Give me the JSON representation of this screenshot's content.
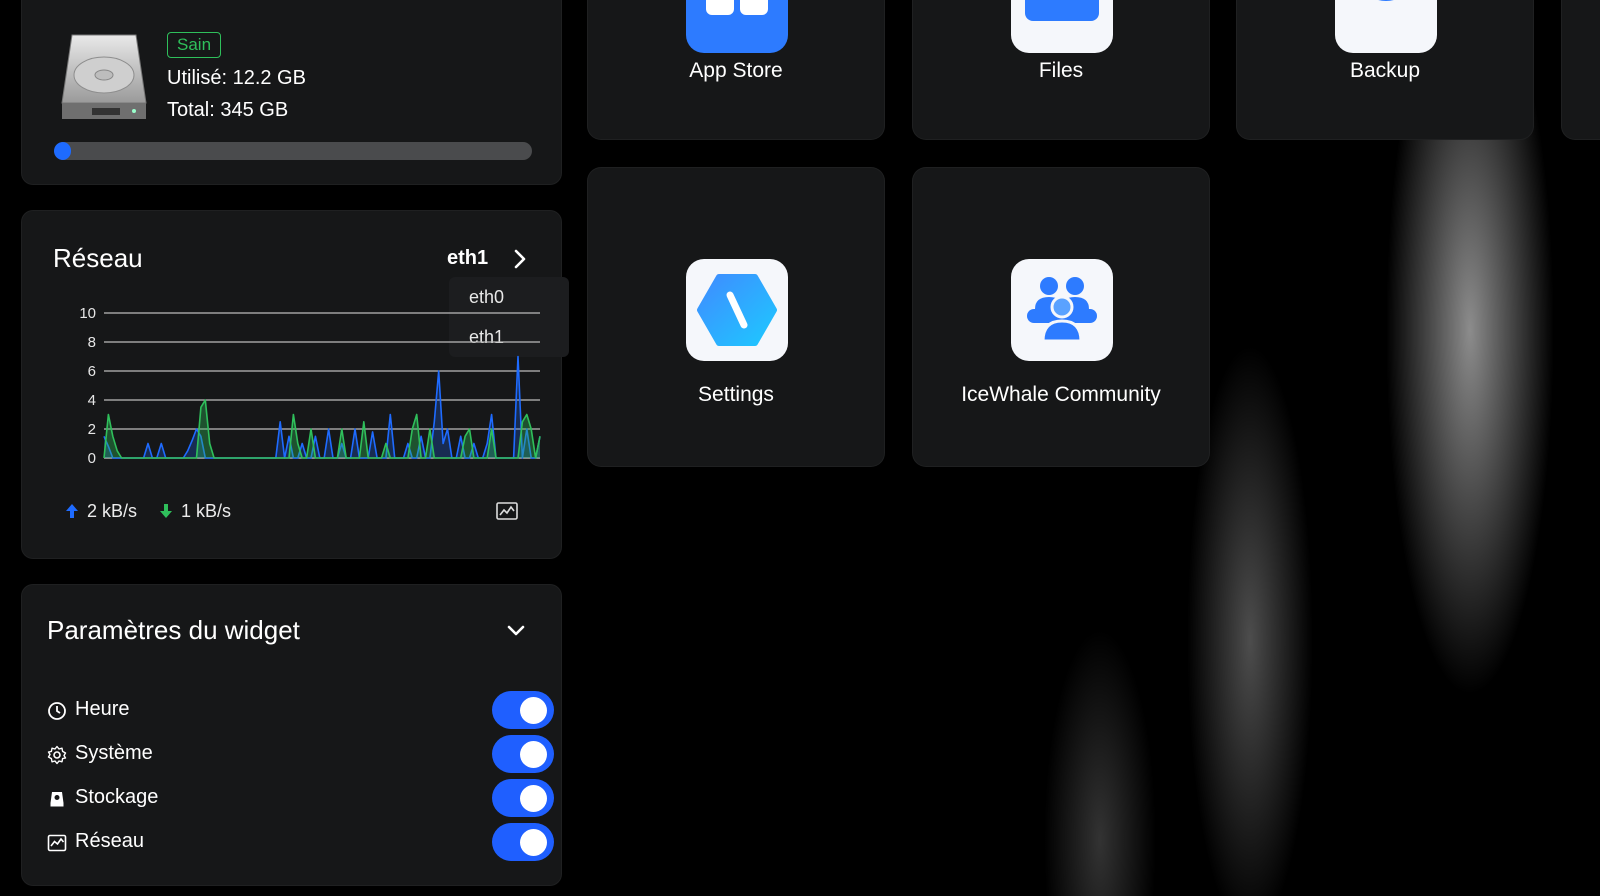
{
  "storage": {
    "status_badge": "Sain",
    "used": "Utilisé: 12.2 GB",
    "total": "Total: 345 GB",
    "usage_fraction": 0.035,
    "icon": "hard-disk-icon"
  },
  "network": {
    "title": "Réseau",
    "selected_interface": "eth1",
    "interfaces": [
      "eth0",
      "eth1"
    ],
    "upload": "2 kB/s",
    "download": "1 kB/s",
    "colors": {
      "upload": "#1e6bff",
      "download": "#2fbf5b"
    }
  },
  "chart_data": {
    "type": "area",
    "y_ticks": [
      "10",
      "8",
      "6",
      "4",
      "2",
      "0"
    ],
    "ylim": [
      0,
      10
    ],
    "x": [
      0,
      1,
      2,
      3,
      4,
      5,
      6,
      7,
      8,
      9,
      10,
      11,
      12,
      13,
      14,
      15,
      16,
      17,
      18,
      19,
      20,
      21,
      22,
      23,
      24,
      25,
      26,
      27,
      28,
      29,
      30,
      31,
      32,
      33,
      34,
      35,
      36,
      37,
      38,
      39,
      40,
      41,
      42,
      43,
      44,
      45,
      46,
      47,
      48,
      49,
      50,
      51,
      52,
      53,
      54,
      55,
      56,
      57,
      58,
      59,
      60,
      61,
      62,
      63,
      64,
      65,
      66,
      67,
      68,
      69,
      70,
      71,
      72,
      73,
      74,
      75,
      76,
      77,
      78,
      79,
      80,
      81,
      82,
      83,
      84,
      85,
      86,
      87,
      88,
      89,
      90,
      91,
      92,
      93,
      94,
      95,
      96,
      97,
      98,
      99
    ],
    "series": [
      {
        "values": [
          1.5,
          0.8,
          0,
          0,
          0,
          0,
          0,
          0,
          0,
          0,
          1,
          0,
          0,
          1,
          0,
          0,
          0,
          0,
          0,
          0.5,
          1.2,
          2,
          1.5,
          0,
          0,
          0,
          0,
          0,
          0,
          0,
          0,
          0,
          0,
          0,
          0,
          0,
          0,
          0,
          0,
          0,
          2.5,
          0,
          1.5,
          0,
          0,
          1,
          0,
          0,
          1.5,
          0,
          0,
          2,
          0,
          0,
          1,
          0,
          0,
          2,
          0,
          0,
          0,
          1.8,
          0,
          0,
          0,
          3,
          0,
          0,
          0,
          1,
          0,
          0,
          1.5,
          0,
          0,
          2.5,
          6,
          1,
          2,
          0,
          0,
          1.5,
          0,
          0,
          1,
          0,
          0,
          1,
          3,
          0,
          0,
          0,
          0,
          0,
          7,
          0,
          2,
          0,
          0,
          1.5
        ]
      },
      {
        "values": [
          0,
          3,
          1.5,
          0.5,
          0,
          0,
          0,
          0,
          0,
          0,
          0,
          0,
          0,
          0,
          0,
          0,
          0,
          0,
          0,
          0,
          0,
          0,
          3.5,
          4,
          1,
          0,
          0,
          0,
          0,
          0,
          0,
          0,
          0,
          0,
          0,
          0,
          0,
          0,
          0,
          0,
          0,
          0,
          0,
          3,
          1,
          0,
          0,
          2,
          0,
          0,
          0,
          0,
          0,
          0,
          2,
          0,
          0,
          0,
          0,
          2.5,
          0,
          0,
          0,
          0,
          1,
          0,
          0,
          0,
          0,
          0,
          2,
          3,
          0,
          0,
          2,
          0,
          0,
          0,
          0,
          0,
          0,
          0,
          1.5,
          2,
          0,
          0,
          0,
          0,
          2,
          0,
          0,
          0,
          0,
          0,
          0,
          2.5,
          3,
          2,
          0,
          1.5
        ]
      }
    ]
  },
  "widget_settings": {
    "title": "Paramètres du widget",
    "items": [
      {
        "label": "Heure",
        "icon": "clock-icon",
        "enabled": true
      },
      {
        "label": "Système",
        "icon": "gear-icon",
        "enabled": true
      },
      {
        "label": "Stockage",
        "icon": "storage-icon",
        "enabled": true
      },
      {
        "label": "Réseau",
        "icon": "network-chart-icon",
        "enabled": true
      }
    ],
    "toggle_color": "#1f5fff"
  },
  "apps": {
    "app_store": "App Store",
    "files": "Files",
    "backup": "Backup",
    "settings": "Settings",
    "community": "IceWhale Community"
  }
}
